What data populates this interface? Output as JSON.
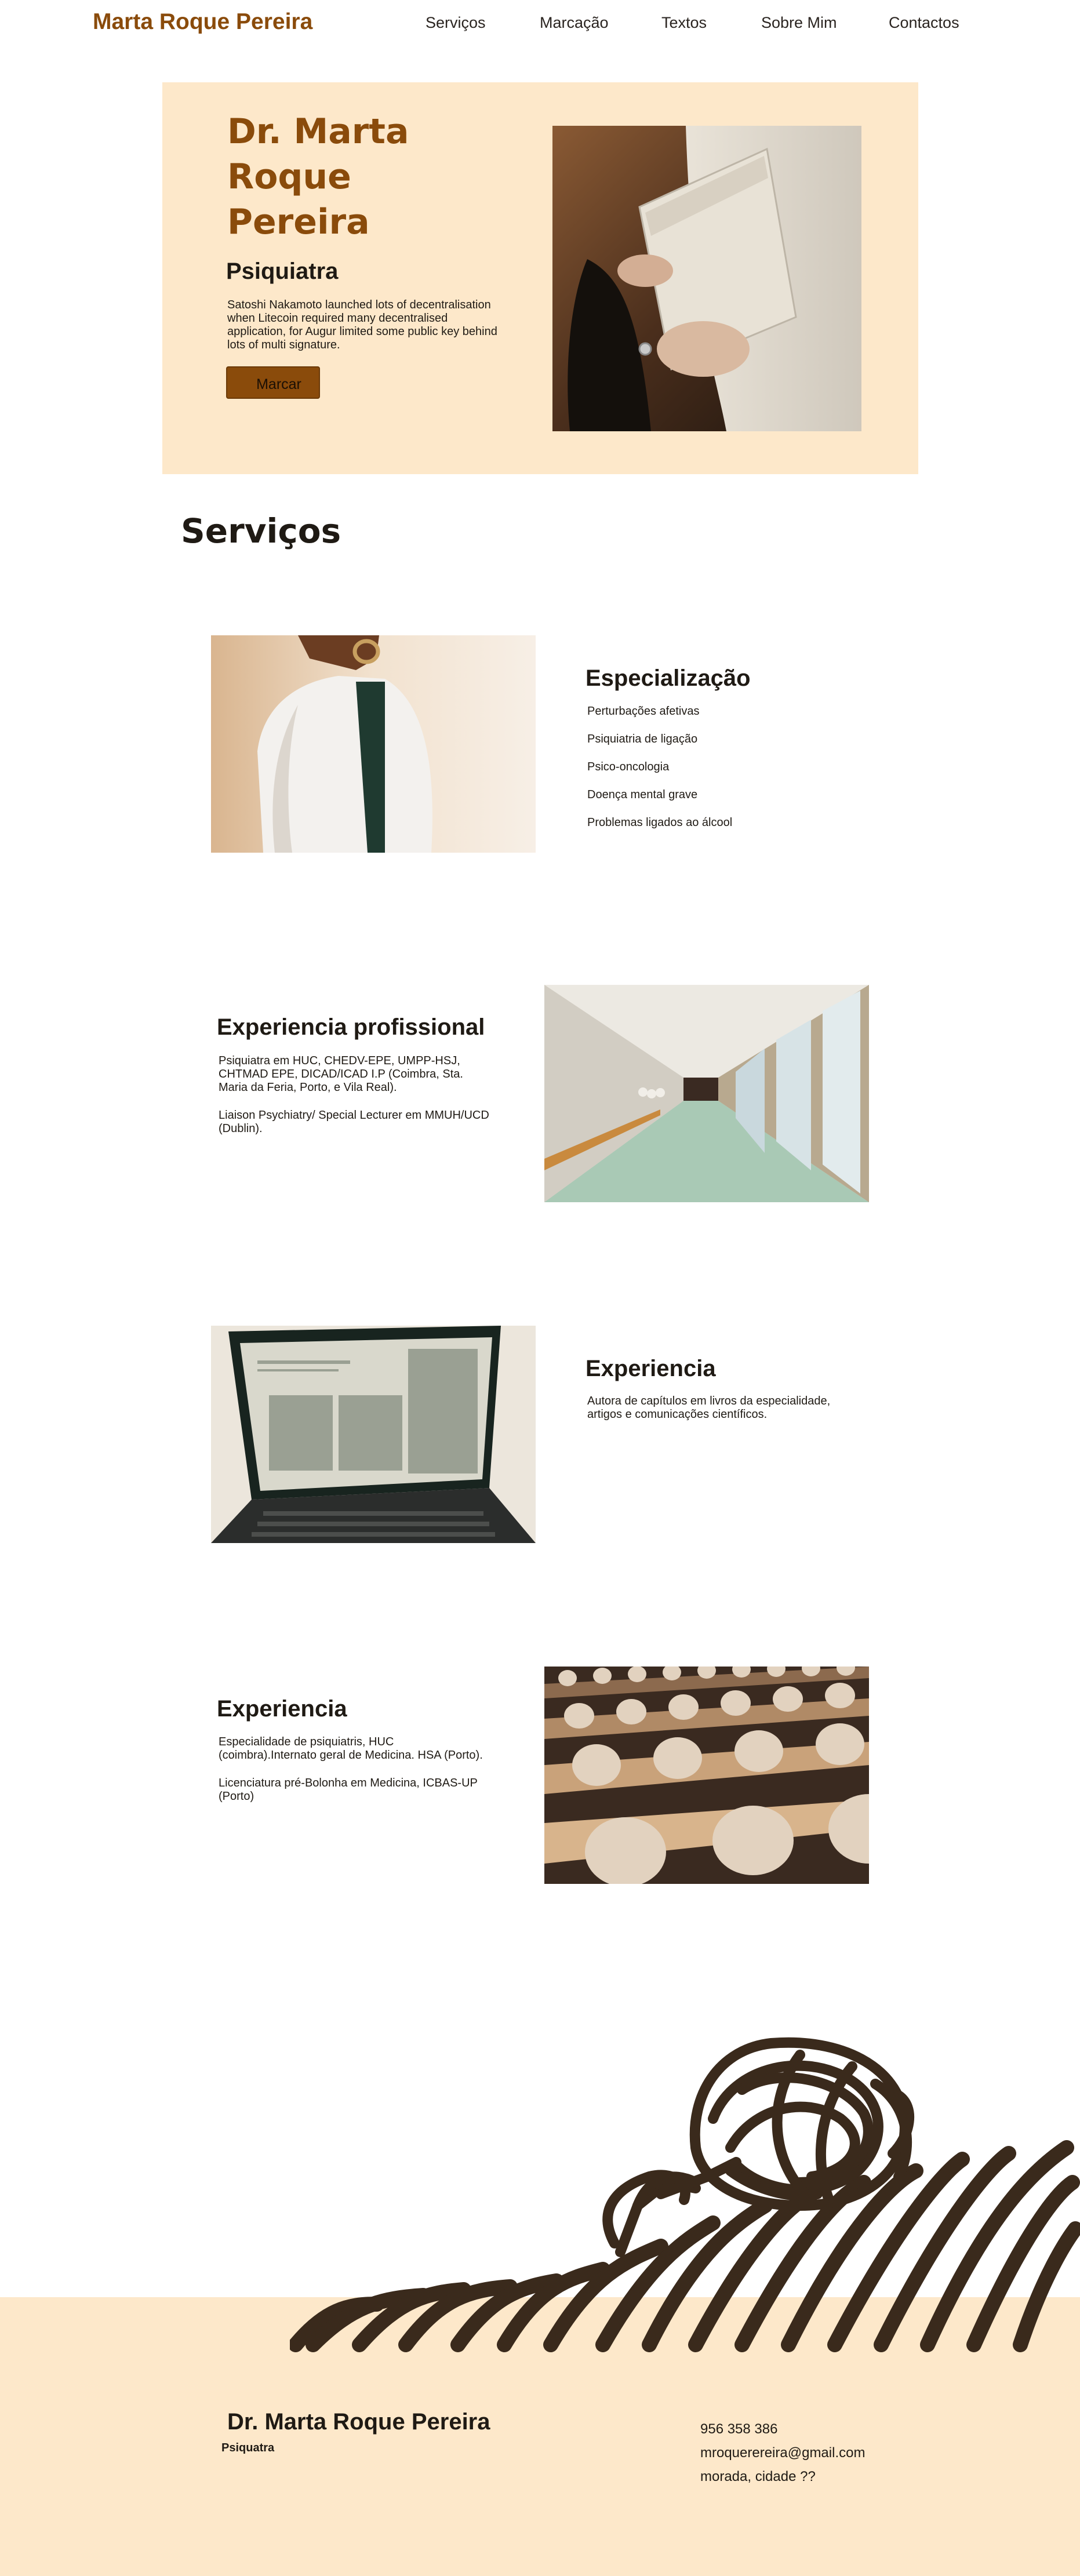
{
  "header": {
    "logo": "Marta Roque Pereira",
    "nav": [
      "Serviços",
      "Marcação",
      "Textos",
      "Sobre Mim",
      "Contactos"
    ]
  },
  "hero": {
    "title_line1": "Dr. Marta",
    "title_line2": "Roque Pereira",
    "role": "Psiquiatra",
    "text": "Satoshi Nakamoto launched lots of decentralisation when Litecoin required many decentralised application, for Augur limited some public key behind lots of multi signature.",
    "button": "Marcar",
    "image": "hands-holding-notebook-photo"
  },
  "services": {
    "title": "Serviços",
    "specialization": {
      "title": "Especialização",
      "items": [
        "Perturbações afetivas",
        "Psiquiatria de ligação",
        "Psico-oncologia",
        "Doença mental grave",
        "Problemas ligados ao álcool"
      ],
      "image": "doctor-white-coat-photo"
    },
    "professional": {
      "title": "Experiencia profissional",
      "paragraphs": [
        "Psiquiatra em HUC, CHEDV-EPE, UMPP-HSJ, CHTMAD EPE, DICAD/ICAD I.P (Coimbra, Sta. Maria da Feria, Porto, e Vila Real).",
        "Liaison Psychiatry/ Special Lecturer em MMUH/UCD (Dublin)."
      ],
      "image": "hospital-corridor-photo"
    },
    "experience1": {
      "title": "Experiencia",
      "paragraphs": [
        "Autora de capítulos em livros da especialidade, artigos e comunicações científicos."
      ],
      "image": "laptop-article-photo"
    },
    "experience2": {
      "title": "Experiencia",
      "paragraphs": [
        "Especialidade de psiquiatris, HUC (coimbra).Internato geral de Medicina. HSA (Porto).",
        "Licenciatura pré-Bolonha em Medicina, ICBAS-UP (Porto)"
      ],
      "image": "lecture-hall-seats-photo"
    }
  },
  "illustration": "sisyphus-pushing-scribble-ball",
  "footer": {
    "name": "Dr. Marta Roque Pereira",
    "role": "Psiquatra",
    "phone": "956 358 386",
    "email": "mroquerereira@gmail.com",
    "address": "morada, cidade ??"
  },
  "colors": {
    "accent": "#8a4b0b",
    "cream": "#fde8ca",
    "ink": "#3a2a1c"
  }
}
